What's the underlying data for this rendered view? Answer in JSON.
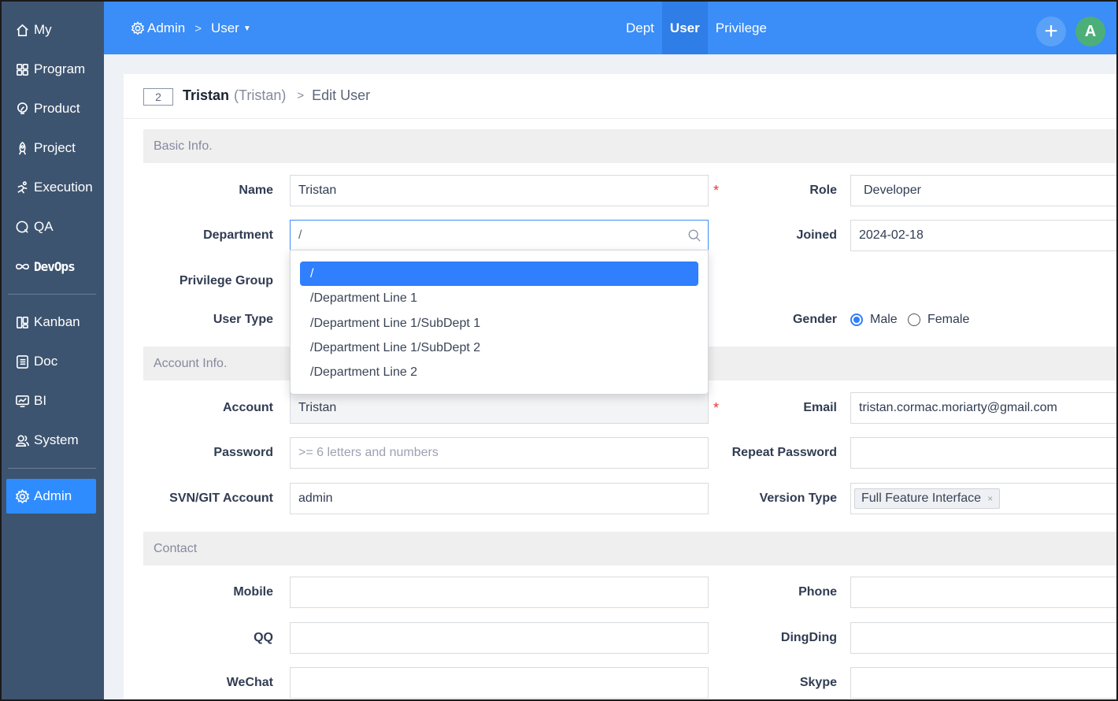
{
  "sidebar": {
    "items": [
      {
        "label": "My",
        "icon": "home-icon"
      },
      {
        "label": "Program",
        "icon": "grid-icon"
      },
      {
        "label": "Product",
        "icon": "bulb-icon"
      },
      {
        "label": "Project",
        "icon": "rocket-icon"
      },
      {
        "label": "Execution",
        "icon": "runner-icon"
      },
      {
        "label": "QA",
        "icon": "qa-icon"
      },
      {
        "label": "DevOps",
        "icon": "infinity-icon"
      },
      {
        "label": "Kanban",
        "icon": "kanban-icon"
      },
      {
        "label": "Doc",
        "icon": "doc-icon"
      },
      {
        "label": "BI",
        "icon": "bi-icon"
      },
      {
        "label": "System",
        "icon": "users-icon"
      },
      {
        "label": "Admin",
        "icon": "gear-icon"
      }
    ],
    "active": "Admin"
  },
  "header": {
    "breadcrumb_root": "Admin",
    "breadcrumb_current": "User",
    "tabs": [
      "Dept",
      "User",
      "Privilege"
    ],
    "active_tab": "User",
    "plus": "+",
    "avatar_letter": "A"
  },
  "title_bar": {
    "id": "2",
    "name": "Tristan",
    "account": "(Tristan)",
    "action": "Edit User"
  },
  "sections": {
    "basic": "Basic Info.",
    "account": "Account Info.",
    "contact": "Contact"
  },
  "basic": {
    "name_label": "Name",
    "name_value": "Tristan",
    "role_label": "Role",
    "role_value": "Developer",
    "dept_label": "Department",
    "dept_value": "/",
    "joined_label": "Joined",
    "joined_value": "2024-02-18",
    "privilege_label": "Privilege Group",
    "usertype_label": "User Type",
    "gender_label": "Gender",
    "gender_options": [
      "Male",
      "Female"
    ],
    "gender_selected": "Male"
  },
  "dept_options": [
    "/",
    "/Department Line 1",
    "/Department Line 1/SubDept 1",
    "/Department Line 1/SubDept 2",
    "/Department Line 2"
  ],
  "account": {
    "account_label": "Account",
    "account_value": "Tristan",
    "email_label": "Email",
    "email_value": "tristan.cormac.moriarty@gmail.com",
    "password_label": "Password",
    "password_placeholder": ">= 6 letters and numbers",
    "repeat_label": "Repeat Password",
    "svn_label": "SVN/GIT Account",
    "svn_value": "admin",
    "version_label": "Version Type",
    "version_value": "Full Feature Interface",
    "chip_remove": "×"
  },
  "contact": {
    "mobile_label": "Mobile",
    "phone_label": "Phone",
    "qq_label": "QQ",
    "dingding_label": "DingDing",
    "wechat_label": "WeChat",
    "skype_label": "Skype"
  },
  "required_mark": "*",
  "colors": {
    "header": "#3b8df7",
    "sidebar": "#3d5470",
    "accent": "#2f7fff",
    "required": "#e53935"
  }
}
